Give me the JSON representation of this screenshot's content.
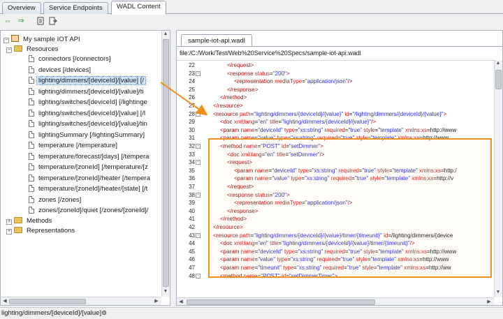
{
  "tabs": [
    "Overview",
    "Service Endpoints",
    "WADL Content"
  ],
  "toolbar": {
    "icons": [
      "expand-icon",
      "collapse-icon",
      "document-icon",
      "export-icon"
    ]
  },
  "tree": {
    "root": "My sample IOT API",
    "resources_label": "Resources",
    "items": [
      "connectors [/connectors]",
      "devices [/devices]",
      "lighting/dimmers/[deviceId]/[value] [/",
      "lighting/dimmers/[deviceId]/[value]/ti",
      "lighting/switches/[deviceId] [/lightinge",
      "lighting/switches/[deviceId]/[value] [/l",
      "lighting/switches/[deviceId]/[value]/tin",
      "lightingSummary [/lightingSummary]",
      "temperature [/temperature]",
      "temperature/forecast/[days] [/tempera",
      "temperature/[zoneId] [/temperature/[z",
      "temperature/[zoneId]/heater [/tempera",
      "temperature/[zoneId]/heater/[state] [/t",
      "zones [/zones]",
      "zones/[zoneId]/quiet [/zones/[zoneId]/"
    ],
    "selected_index": 2,
    "methods_label": "Methods",
    "representations_label": "Representations"
  },
  "editor": {
    "file_tab": "sample-iot-api.wadl",
    "path": "file:/C:/Work/Test/Web%20Service%20Specs/sample-iot-api.wadl",
    "lines": [
      {
        "n": "22",
        "fold": "",
        "indent": 3,
        "code": "</request>"
      },
      {
        "n": "23",
        "fold": "-",
        "indent": 3,
        "code": "<response status=\"200\">"
      },
      {
        "n": "24",
        "fold": "",
        "indent": 4,
        "code": "<representation mediaType=\"application/json\"/>"
      },
      {
        "n": "25",
        "fold": "",
        "indent": 3,
        "code": "</response>"
      },
      {
        "n": "26",
        "fold": "",
        "indent": 2,
        "code": "</method>"
      },
      {
        "n": "27",
        "fold": "",
        "indent": 1,
        "code": "</resource>"
      },
      {
        "n": "28",
        "fold": "-",
        "indent": 1,
        "code": "<resource path=\"lighting/dimmers/{deviceId}/{value}\" id=\"/lighting/dimmers/{deviceId}/{value}\">"
      },
      {
        "n": "29",
        "fold": "",
        "indent": 2,
        "code": "<doc xml:lang=\"en\" title=\"lighting/dimmers/{deviceId}/{value}\"/>"
      },
      {
        "n": "30",
        "fold": "",
        "indent": 2,
        "code": "<param name=\"deviceId\" type=\"xs:string\" required=\"true\" style=\"template\" xmlns:xs=\"http://www"
      },
      {
        "n": "31",
        "fold": "",
        "indent": 2,
        "code": "<param name=\"value\" type=\"xs:string\" required=\"true\" style=\"template\" xmlns:xs=\"http://www"
      },
      {
        "n": "32",
        "fold": "-",
        "indent": 2,
        "code": "<method name=\"POST\" id=\"setDimmer\">"
      },
      {
        "n": "33",
        "fold": "",
        "indent": 3,
        "code": "<doc xml:lang=\"en\" title=\"setDimmer\"/>"
      },
      {
        "n": "34",
        "fold": "-",
        "indent": 3,
        "code": "<request>"
      },
      {
        "n": "35",
        "fold": "",
        "indent": 4,
        "code": "<param name=\"deviceId\" type=\"xs:string\" required=\"true\" style=\"template\" xmlns:xs=\"http:/"
      },
      {
        "n": "36",
        "fold": "",
        "indent": 4,
        "code": "<param name=\"value\" type=\"xs:string\" required=\"true\" style=\"template\" xmlns:xs=\"http://v"
      },
      {
        "n": "37",
        "fold": "",
        "indent": 3,
        "code": "</request>"
      },
      {
        "n": "38",
        "fold": "-",
        "indent": 3,
        "code": "<response status=\"200\">"
      },
      {
        "n": "39",
        "fold": "",
        "indent": 4,
        "code": "<representation mediaType=\"application/json\"/>"
      },
      {
        "n": "40",
        "fold": "",
        "indent": 3,
        "code": "</response>"
      },
      {
        "n": "41",
        "fold": "",
        "indent": 2,
        "code": "</method>"
      },
      {
        "n": "42",
        "fold": "",
        "indent": 1,
        "code": "</resource>"
      },
      {
        "n": "43",
        "fold": "-",
        "indent": 1,
        "code": "<resource path=\"lighting/dimmers/{deviceId}/{value}/timer/{timeunit}\" id=\"/lighting/dimmers/{device"
      },
      {
        "n": "44",
        "fold": "",
        "indent": 2,
        "code": "<doc xml:lang=\"en\" title=\"lighting/dimmers/{deviceId}/{value}/timer/{timeunit}\"/>"
      },
      {
        "n": "45",
        "fold": "",
        "indent": 2,
        "code": "<param name=\"deviceId\" type=\"xs:string\" required=\"true\" style=\"template\" xmlns:xs=\"http://www"
      },
      {
        "n": "46",
        "fold": "",
        "indent": 2,
        "code": "<param name=\"value\" type=\"xs:string\" required=\"true\" style=\"template\" xmlns:xs=\"http://www"
      },
      {
        "n": "47",
        "fold": "",
        "indent": 2,
        "code": "<param name=\"timeunit\" type=\"xs:string\" required=\"true\" style=\"template\" xmlns:xs=\"http://ww"
      },
      {
        "n": "48",
        "fold": "-",
        "indent": 2,
        "code": "<method name=\"POST\" id=\"setDimmerTimer\">"
      }
    ]
  },
  "status": "lighting/dimmers/[deviceId]/[value]",
  "colors": {
    "highlight_border": "#f0901e",
    "selection": "#cce4f7",
    "xml_tag": "#a11010",
    "xml_attr": "#cc2020",
    "xml_value": "#3030c8"
  }
}
